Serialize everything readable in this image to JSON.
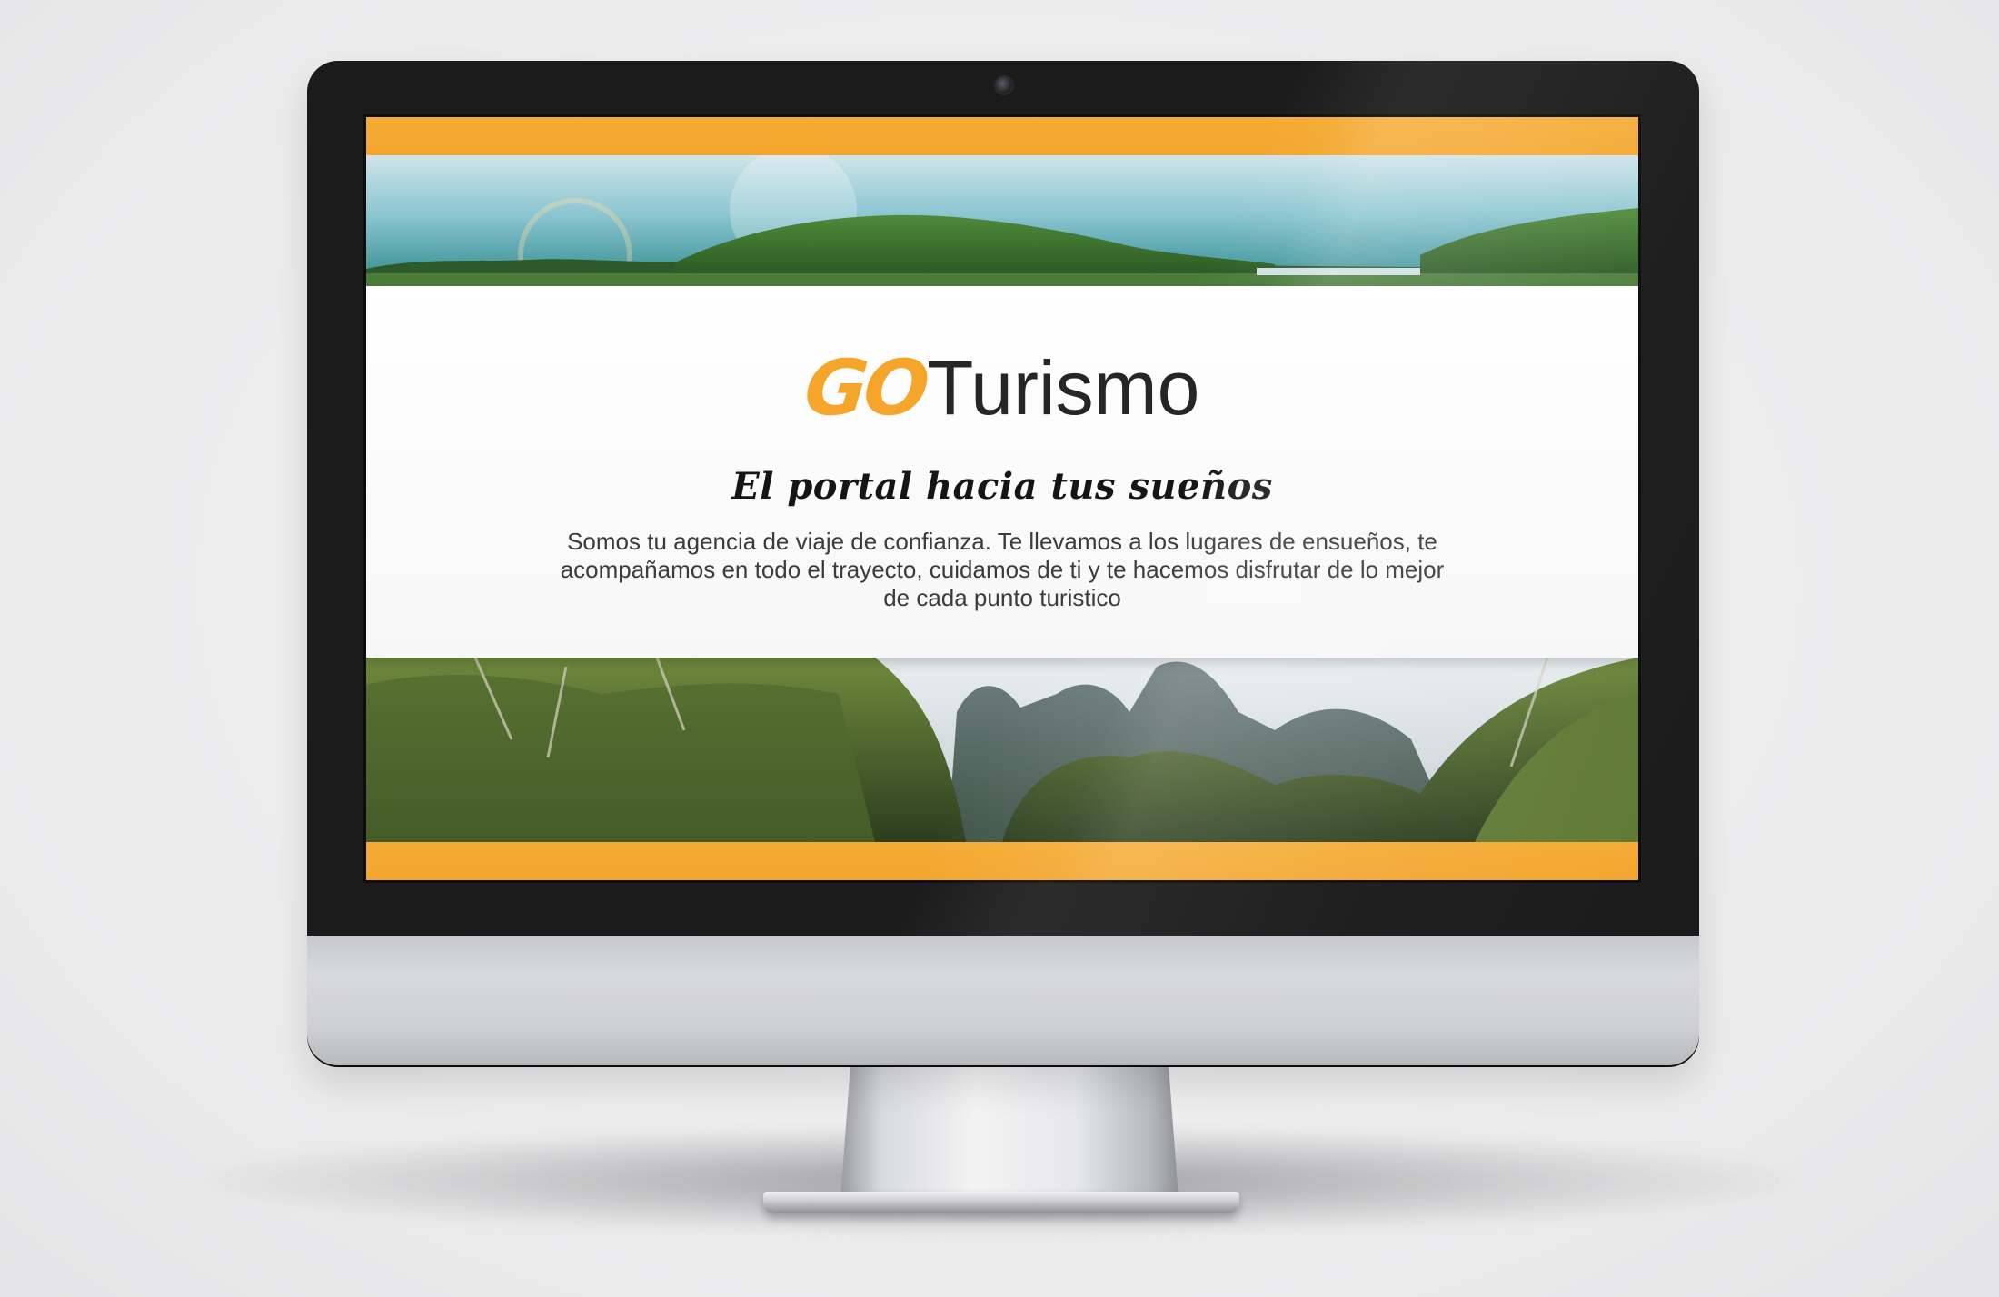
{
  "site": {
    "logo": {
      "accent": "GO",
      "name": "Turismo"
    },
    "tagline": "El portal hacia tus sueños",
    "description": "Somos tu agencia de viaje de confianza. Te llevamos a los lugares de ensueños, te acompañamos en todo el trayecto, cuidamos de ti y te hacemos disfrutar de lo mejor de cada punto turistico"
  },
  "colors": {
    "accent": "#f4a52a",
    "text_dark": "#262626",
    "text_body": "#3c3c3c",
    "background": "#ffffff"
  },
  "images": {
    "top_banner": "tropical-island-coast-photo",
    "bottom_banner": "jungle-limestone-cliffs-photo"
  }
}
